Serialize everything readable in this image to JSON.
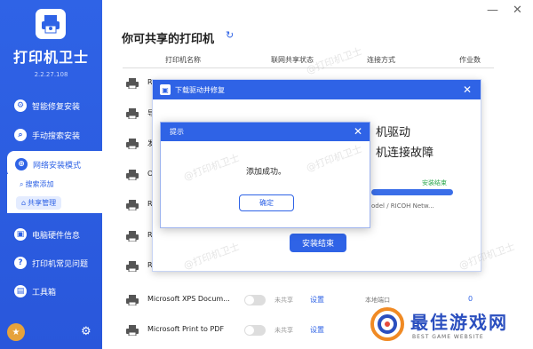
{
  "app": {
    "title": "打印机卫士",
    "version": "2.2.27.108"
  },
  "sidebar": {
    "items": [
      {
        "label": "智能修复安装",
        "icon": "repair-icon"
      },
      {
        "label": "手动搜索安装",
        "icon": "search-install-icon"
      },
      {
        "label": "网络安装模式",
        "icon": "network-icon"
      },
      {
        "label": "电脑硬件信息",
        "icon": "hardware-icon"
      },
      {
        "label": "打印机常见问题",
        "icon": "faq-icon"
      },
      {
        "label": "工具箱",
        "icon": "toolbox-icon"
      }
    ],
    "sub_items": [
      {
        "label": "搜索添加",
        "icon": "search-icon"
      },
      {
        "label": "共享管理",
        "icon": "share-icon"
      }
    ]
  },
  "main": {
    "heading": "你可共享的打印机",
    "columns": [
      "打印机名称",
      "联网共享状态",
      "连接方式",
      "作业数"
    ],
    "rows": [
      {
        "name": "R",
        "share": "",
        "set": "",
        "conn": "",
        "jobs": ""
      },
      {
        "name": "导",
        "share": "",
        "set": "",
        "conn": "",
        "jobs": ""
      },
      {
        "name": "发",
        "share": "",
        "set": "",
        "conn": "",
        "jobs": ""
      },
      {
        "name": "O",
        "share": "",
        "set": "",
        "conn": "",
        "jobs": ""
      },
      {
        "name": "R",
        "share": "",
        "set": "",
        "conn": "",
        "jobs": ""
      },
      {
        "name": "R",
        "share": "",
        "set": "",
        "conn": "",
        "jobs": ""
      },
      {
        "name": "R",
        "share": "",
        "set": "",
        "conn": "",
        "jobs": ""
      },
      {
        "name": "Microsoft XPS Docum...",
        "share": "未共享",
        "set": "设置",
        "conn": "本地端口",
        "jobs": "0"
      },
      {
        "name": "Microsoft Print to PDF",
        "share": "未共享",
        "set": "设置",
        "conn": "",
        "jobs": ""
      }
    ]
  },
  "dialog_driver": {
    "title": "下载驱动并修复",
    "line1": "机驱动",
    "line2": "机连接故障",
    "status": "安装结束",
    "progress": 1.0,
    "model": "odel / RICOH Netw...",
    "button": "安装结束"
  },
  "dialog_tip": {
    "title": "提示",
    "message": "添加成功。",
    "ok": "确定"
  },
  "watermark": "@打印机卫士",
  "brand": {
    "name": "最佳游戏网",
    "sub": "BEST GAME WEBSITE"
  }
}
